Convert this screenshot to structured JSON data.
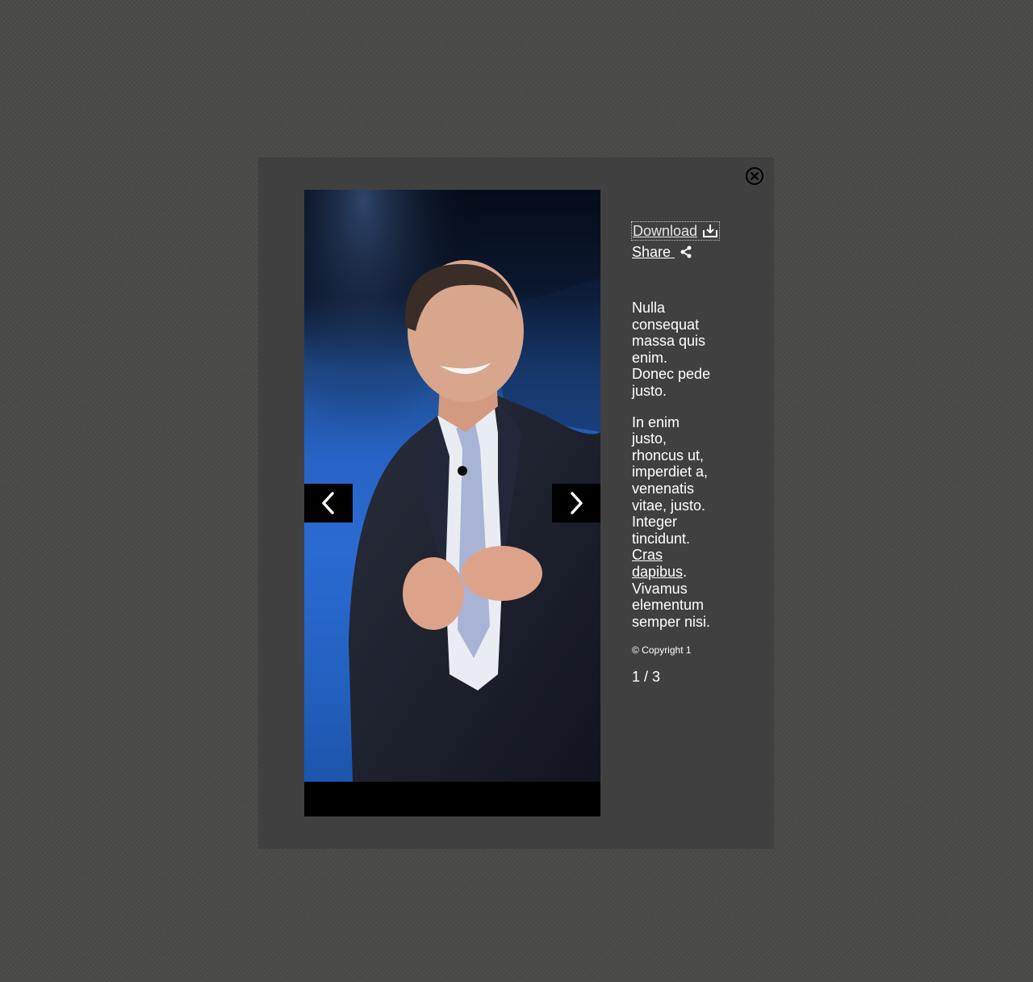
{
  "modal": {
    "close_label": "close",
    "download_label": "Download",
    "share_label": "Share",
    "description": {
      "paragraph1": "Nulla consequat massa quis enim. Donec pede justo.",
      "paragraph2_before": "In enim justo, rhoncus ut, imperdiet a, venenatis vitae, justo. Integer tincidunt.",
      "paragraph2_link": "Cras dapibus",
      "paragraph2_after": ". Vivamus elementum semper nisi."
    },
    "copyright": "© Copyright 1",
    "counter": "1 / 3"
  },
  "icons": {
    "close": "close-icon",
    "download": "download-icon",
    "share": "share-icon",
    "prev": "chevron-left-icon",
    "next": "chevron-right-icon"
  },
  "colors": {
    "backdrop": "#4a4b49",
    "modal_bg": "#404040",
    "nav_bg": "#000000",
    "text": "#ffffff"
  }
}
